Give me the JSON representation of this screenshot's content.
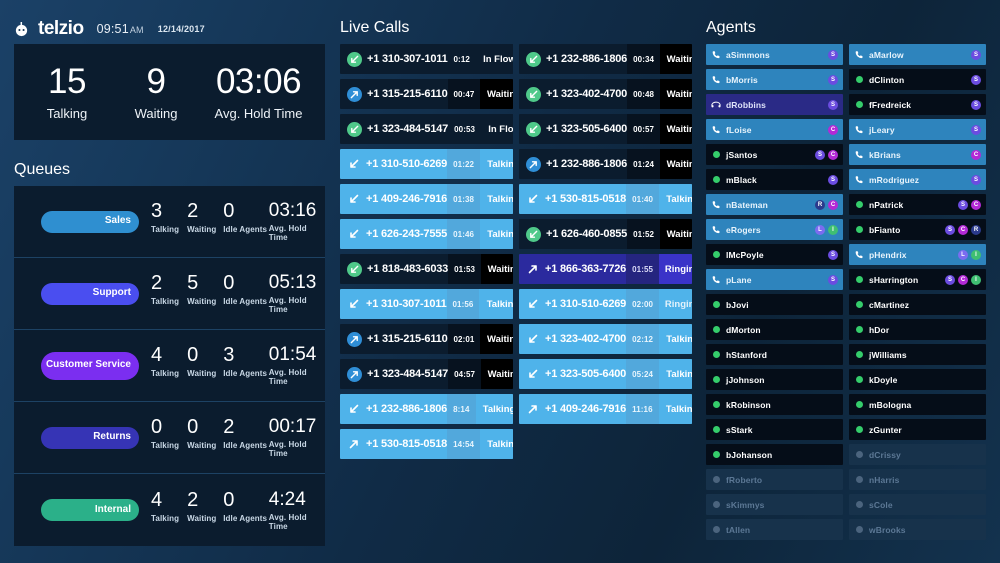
{
  "header": {
    "brand": "telzio",
    "logo_icon": "telzio-logo-icon",
    "time": "09:51",
    "ampm": "AM",
    "date": "12/14/2017"
  },
  "summary": {
    "talking_value": "15",
    "talking_label": "Talking",
    "waiting_value": "9",
    "waiting_label": "Waiting",
    "hold_value": "03:06",
    "hold_label": "Avg. Hold Time"
  },
  "queues": {
    "title": "Queues",
    "stat_labels": [
      "Talking",
      "Waiting",
      "Idle Agents",
      "Avg. Hold Time"
    ],
    "rows": [
      {
        "name": "Sales",
        "color": "#2f8fd0",
        "talking": "3",
        "waiting": "2",
        "idle": "0",
        "hold": "03:16",
        "two_line": false
      },
      {
        "name": "Support",
        "color": "#4a4ef0",
        "talking": "2",
        "waiting": "5",
        "idle": "0",
        "hold": "05:13",
        "two_line": false
      },
      {
        "name": "Customer Service",
        "color": "#7b2ef0",
        "talking": "4",
        "waiting": "0",
        "idle": "3",
        "hold": "01:54",
        "two_line": true
      },
      {
        "name": "Returns",
        "color": "#3634b5",
        "talking": "0",
        "waiting": "0",
        "idle": "2",
        "hold": "00:17",
        "two_line": false
      },
      {
        "name": "Internal",
        "color": "#2bb089",
        "talking": "4",
        "waiting": "2",
        "idle": "0",
        "hold": "4:24",
        "two_line": false
      }
    ]
  },
  "live_calls": {
    "title": "Live Calls",
    "columns": [
      [
        {
          "direction": "inbound",
          "icon": "inbound-call-icon",
          "number": "+1 310-307-1011",
          "duration": "0:12",
          "state": "In Flow"
        },
        {
          "direction": "outbound",
          "icon": "outbound-call-icon",
          "number": "+1 315-215-6110",
          "duration": "00:47",
          "state": "Waiting"
        },
        {
          "direction": "inbound",
          "icon": "inbound-call-icon",
          "number": "+1 323-484-5147",
          "duration": "00:53",
          "state": "In Flow"
        },
        {
          "direction": "inbound",
          "icon": "inbound-arrow-icon",
          "number": "+1 310-510-6269",
          "duration": "01:22",
          "state": "Talking"
        },
        {
          "direction": "inbound",
          "icon": "inbound-arrow-icon",
          "number": "+1 409-246-7916",
          "duration": "01:38",
          "state": "Talking"
        },
        {
          "direction": "inbound",
          "icon": "inbound-arrow-icon",
          "number": "+1 626-243-7555",
          "duration": "01:46",
          "state": "Talking"
        },
        {
          "direction": "inbound",
          "icon": "inbound-call-icon",
          "number": "+1 818-483-6033",
          "duration": "01:53",
          "state": "Waiting"
        },
        {
          "direction": "inbound",
          "icon": "inbound-arrow-icon",
          "number": "+1 310-307-1011",
          "duration": "01:56",
          "state": "Talking"
        },
        {
          "direction": "outbound",
          "icon": "outbound-call-icon",
          "number": "+1 315-215-6110",
          "duration": "02:01",
          "state": "Waiting"
        },
        {
          "direction": "outbound",
          "icon": "outbound-call-icon",
          "number": "+1 323-484-5147",
          "duration": "04:57",
          "state": "Waiting"
        },
        {
          "direction": "inbound",
          "icon": "inbound-arrow-icon",
          "number": "+1 232-886-1806",
          "duration": "8:14",
          "state": "Talking"
        },
        {
          "direction": "outbound",
          "icon": "outbound-arrow-icon",
          "number": "+1 530-815-0518",
          "duration": "14:54",
          "state": "Talking"
        }
      ],
      [
        {
          "direction": "inbound",
          "icon": "inbound-call-icon",
          "number": "+1 232-886-1806",
          "duration": "00:34",
          "state": "Waiting"
        },
        {
          "direction": "inbound",
          "icon": "inbound-call-icon",
          "number": "+1 323-402-4700",
          "duration": "00:48",
          "state": "Waiting"
        },
        {
          "direction": "inbound",
          "icon": "inbound-call-icon",
          "number": "+1 323-505-6400",
          "duration": "00:57",
          "state": "Waiting"
        },
        {
          "direction": "outbound",
          "icon": "outbound-call-icon",
          "number": "+1 232-886-1806",
          "duration": "01:24",
          "state": "Waiting"
        },
        {
          "direction": "inbound",
          "icon": "inbound-arrow-icon",
          "number": "+1 530-815-0518",
          "duration": "01:40",
          "state": "Talking"
        },
        {
          "direction": "inbound",
          "icon": "inbound-call-icon",
          "number": "+1 626-460-0855",
          "duration": "01:52",
          "state": "Waiting"
        },
        {
          "direction": "outbound",
          "icon": "outbound-arrow-icon",
          "number": "+1 866-363-7726",
          "duration": "01:55",
          "state": "Ringing"
        },
        {
          "direction": "inbound",
          "icon": "inbound-arrow-icon",
          "number": "+1 310-510-6269",
          "duration": "02:00",
          "state": "Ringing"
        },
        {
          "direction": "inbound",
          "icon": "inbound-arrow-icon",
          "number": "+1 323-402-4700",
          "duration": "02:12",
          "state": "Talking"
        },
        {
          "direction": "inbound",
          "icon": "inbound-arrow-icon",
          "number": "+1 323-505-6400",
          "duration": "05:24",
          "state": "Talking"
        },
        {
          "direction": "outbound",
          "icon": "outbound-arrow-icon",
          "number": "+1 409-246-7916",
          "duration": "11:16",
          "state": "Talking"
        }
      ]
    ]
  },
  "agents": {
    "title": "Agents",
    "badge_colors": {
      "S": "#6b4ce0",
      "C": "#b32ad6",
      "R": "#2b3a8c",
      "L": "#7b6cf0",
      "I": "#3fbf72"
    },
    "columns": [
      [
        {
          "name": "aSimmons",
          "status": "oncall",
          "icon": "phone-icon",
          "badges": [
            "S"
          ]
        },
        {
          "name": "bMorris",
          "status": "oncall",
          "icon": "phone-icon",
          "badges": [
            "S"
          ]
        },
        {
          "name": "dRobbins",
          "status": "ringing",
          "icon": "ringing-icon",
          "badges": [
            "S"
          ]
        },
        {
          "name": "fLoise",
          "status": "oncall",
          "icon": "phone-icon",
          "badges": [
            "C"
          ]
        },
        {
          "name": "jSantos",
          "status": "idle",
          "icon": "status-dot",
          "badges": [
            "S",
            "C"
          ]
        },
        {
          "name": "mBlack",
          "status": "idle",
          "icon": "status-dot",
          "badges": [
            "S"
          ]
        },
        {
          "name": "nBateman",
          "status": "oncall",
          "icon": "phone-icon",
          "badges": [
            "R",
            "C"
          ]
        },
        {
          "name": "eRogers",
          "status": "oncall",
          "icon": "phone-icon",
          "badges": [
            "L",
            "I"
          ]
        },
        {
          "name": "lMcPoyle",
          "status": "idle",
          "icon": "status-dot",
          "badges": [
            "S"
          ]
        },
        {
          "name": "pLane",
          "status": "oncall",
          "icon": "phone-icon",
          "badges": [
            "S"
          ]
        },
        {
          "name": "bJovi",
          "status": "idle",
          "icon": "status-dot",
          "badges": []
        },
        {
          "name": "dMorton",
          "status": "idle",
          "icon": "status-dot",
          "badges": []
        },
        {
          "name": "hStanford",
          "status": "idle",
          "icon": "status-dot",
          "badges": []
        },
        {
          "name": "jJohnson",
          "status": "idle",
          "icon": "status-dot",
          "badges": []
        },
        {
          "name": "kRobinson",
          "status": "idle",
          "icon": "status-dot",
          "badges": []
        },
        {
          "name": "sStark",
          "status": "idle",
          "icon": "status-dot",
          "badges": []
        },
        {
          "name": "bJohanson",
          "status": "idle",
          "icon": "status-dot",
          "badges": []
        },
        {
          "name": "fRoberto",
          "status": "offline",
          "icon": "status-dot",
          "badges": []
        },
        {
          "name": "sKimmys",
          "status": "offline",
          "icon": "status-dot",
          "badges": []
        },
        {
          "name": "tAllen",
          "status": "offline",
          "icon": "status-dot",
          "badges": []
        }
      ],
      [
        {
          "name": "aMarlow",
          "status": "oncall",
          "icon": "phone-icon",
          "badges": [
            "S"
          ]
        },
        {
          "name": "dClinton",
          "status": "idle",
          "icon": "status-dot",
          "badges": [
            "S"
          ]
        },
        {
          "name": "fFredreick",
          "status": "idle",
          "icon": "status-dot",
          "badges": [
            "S"
          ]
        },
        {
          "name": "jLeary",
          "status": "oncall",
          "icon": "phone-icon",
          "badges": [
            "S"
          ]
        },
        {
          "name": "kBrians",
          "status": "oncall",
          "icon": "phone-icon",
          "badges": [
            "C"
          ]
        },
        {
          "name": "mRodriguez",
          "status": "oncall",
          "icon": "phone-icon",
          "badges": [
            "S"
          ]
        },
        {
          "name": "nPatrick",
          "status": "idle",
          "icon": "status-dot",
          "badges": [
            "S",
            "C"
          ]
        },
        {
          "name": "bFianto",
          "status": "idle",
          "icon": "status-dot",
          "badges": [
            "S",
            "C",
            "R"
          ]
        },
        {
          "name": "pHendrix",
          "status": "oncall",
          "icon": "phone-icon",
          "badges": [
            "L",
            "I"
          ]
        },
        {
          "name": "sHarrington",
          "status": "idle",
          "icon": "status-dot",
          "badges": [
            "S",
            "C",
            "I"
          ]
        },
        {
          "name": "cMartinez",
          "status": "idle",
          "icon": "status-dot",
          "badges": []
        },
        {
          "name": "hDor",
          "status": "idle",
          "icon": "status-dot",
          "badges": []
        },
        {
          "name": "jWilliams",
          "status": "idle",
          "icon": "status-dot",
          "badges": []
        },
        {
          "name": "kDoyle",
          "status": "idle",
          "icon": "status-dot",
          "badges": []
        },
        {
          "name": "mBologna",
          "status": "idle",
          "icon": "status-dot",
          "badges": []
        },
        {
          "name": "zGunter",
          "status": "idle",
          "icon": "status-dot",
          "badges": []
        },
        {
          "name": "dCrissy",
          "status": "offline",
          "icon": "status-dot",
          "badges": []
        },
        {
          "name": "nHarris",
          "status": "offline",
          "icon": "status-dot",
          "badges": []
        },
        {
          "name": "sCole",
          "status": "offline",
          "icon": "status-dot",
          "badges": []
        },
        {
          "name": "wBrooks",
          "status": "offline",
          "icon": "status-dot",
          "badges": []
        }
      ]
    ]
  }
}
